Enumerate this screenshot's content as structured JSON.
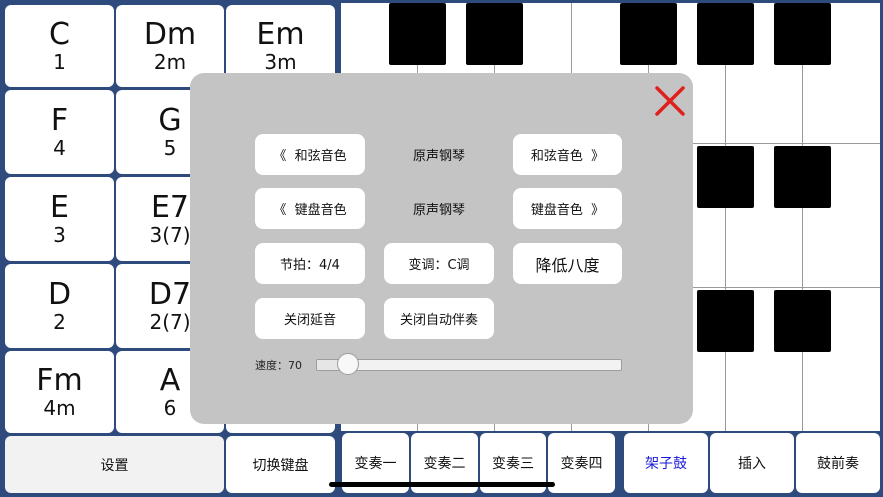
{
  "chords": [
    {
      "name": "C",
      "num": "1"
    },
    {
      "name": "Dm",
      "num": "2m"
    },
    {
      "name": "Em",
      "num": "3m"
    },
    {
      "name": "F",
      "num": "4"
    },
    {
      "name": "G",
      "num": "5"
    },
    {
      "name": "E",
      "num": "3"
    },
    {
      "name": "E7",
      "num": "3(7)"
    },
    {
      "name": "D",
      "num": "2"
    },
    {
      "name": "D7",
      "num": "2(7)"
    },
    {
      "name": "Fm",
      "num": "4m"
    },
    {
      "name": "A",
      "num": "6"
    }
  ],
  "bottom_bar": {
    "settings": "设置",
    "switch_keyboard": "切换键盘",
    "variation1": "变奏一",
    "variation2": "变奏二",
    "variation3": "变奏三",
    "variation4": "变奏四",
    "drum_kit": "架子鼓",
    "insert": "插入",
    "drum_intro": "鼓前奏"
  },
  "settings_panel": {
    "chord_tone_prev": "《  和弦音色",
    "chord_tone_value": "原声钢琴",
    "chord_tone_next": "和弦音色  》",
    "key_tone_prev": "《  键盘音色",
    "key_tone_value": "原声钢琴",
    "key_tone_next": "键盘音色  》",
    "meter": "节拍：4/4",
    "transpose": "变调：C调",
    "lower_octave": "降低八度",
    "sustain_off": "关闭延音",
    "auto_accomp_off": "关闭自动伴奏",
    "speed_label": "速度：70",
    "speed_value": 70,
    "speed_fraction": 0.1
  },
  "colors": {
    "background": "#2f4a7d",
    "close_icon": "#e0201c",
    "drum_kit_active": "#1a1adb",
    "overlay": "#c4c4c4"
  }
}
